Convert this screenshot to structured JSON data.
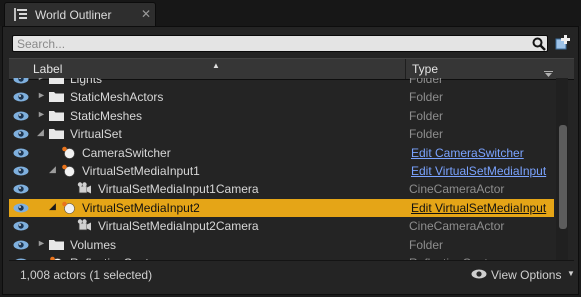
{
  "tab": {
    "title": "World Outliner",
    "close": "✕"
  },
  "search": {
    "placeholder": "Search..."
  },
  "columns": {
    "label": "Label",
    "type": "Type"
  },
  "rows": [
    {
      "name": "Lights",
      "type": "Folder",
      "kind": "folder",
      "depth": 1,
      "arrow": "►",
      "link": false
    },
    {
      "name": "StaticMeshActors",
      "type": "Folder",
      "kind": "folder",
      "depth": 1,
      "arrow": "►",
      "link": false
    },
    {
      "name": "StaticMeshes",
      "type": "Folder",
      "kind": "folder",
      "depth": 1,
      "arrow": "►",
      "link": false
    },
    {
      "name": "VirtualSet",
      "type": "Folder",
      "kind": "folder",
      "depth": 1,
      "arrow": "◢",
      "link": false
    },
    {
      "name": "CameraSwitcher",
      "type": "Edit CameraSwitcher",
      "kind": "actor",
      "depth": 2,
      "arrow": "",
      "link": true
    },
    {
      "name": "VirtualSetMediaInput1",
      "type": "Edit VirtualSetMediaInput",
      "kind": "actor",
      "depth": 2,
      "arrow": "◢",
      "link": true
    },
    {
      "name": "VirtualSetMediaInput1Camera",
      "type": "CineCameraActor",
      "kind": "camera",
      "depth": 3,
      "arrow": "",
      "link": false
    },
    {
      "name": "VirtualSetMediaInput2",
      "type": "Edit VirtualSetMediaInput",
      "kind": "actor",
      "depth": 2,
      "arrow": "◢",
      "link": true,
      "selected": true
    },
    {
      "name": "VirtualSetMediaInput2Camera",
      "type": "CineCameraActor",
      "kind": "camera",
      "depth": 3,
      "arrow": "",
      "link": false
    },
    {
      "name": "Volumes",
      "type": "Folder",
      "kind": "folder",
      "depth": 1,
      "arrow": "►",
      "link": false
    },
    {
      "name": "ReflectionCapture",
      "type": "ReflectionCapture",
      "kind": "actor",
      "depth": 1,
      "arrow": "",
      "link": false
    }
  ],
  "footer": {
    "status": "1,008 actors (1 selected)",
    "view_options": "View Options"
  },
  "colors": {
    "selection": "#e5a517",
    "link": "#7aa3ff",
    "eye": "#7fb0de",
    "folder": "#e8e8e8"
  },
  "icons": {
    "tab": "outliner-list-icon",
    "search": "search-icon",
    "add": "add-actor-icon",
    "eye": "eye-icon",
    "folder": "folder-icon",
    "actor": "actor-sphere-icon",
    "camera": "cine-camera-icon"
  }
}
